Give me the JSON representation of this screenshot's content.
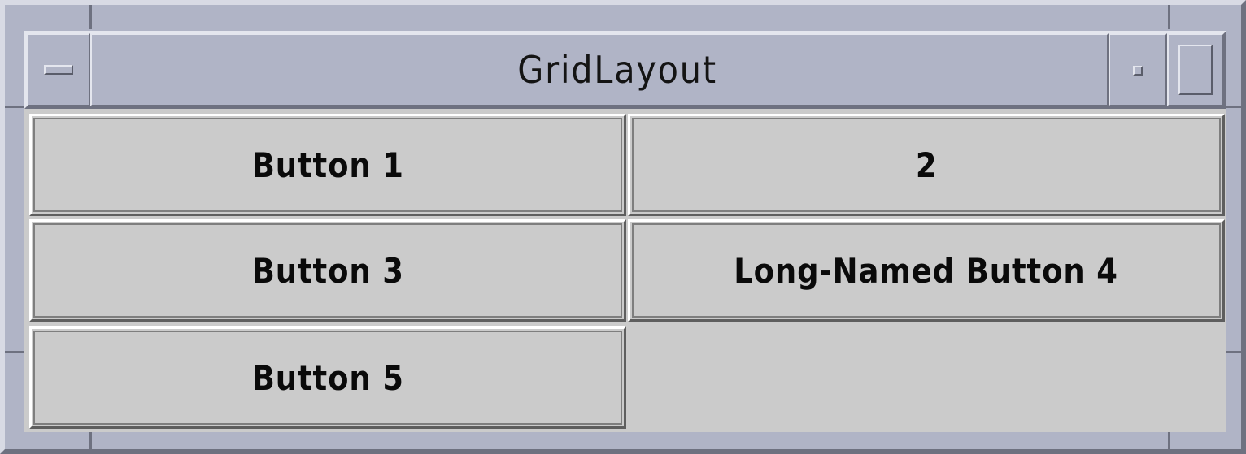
{
  "window": {
    "title": "GridLayout",
    "menu_icon": "window-menu-icon",
    "minimize_icon": "minimize-icon",
    "maximize_icon": "maximize-icon"
  },
  "buttons": [
    {
      "label": "Button 1"
    },
    {
      "label": "2"
    },
    {
      "label": "Button 3"
    },
    {
      "label": "Long-Named Button 4"
    },
    {
      "label": "Button 5"
    }
  ],
  "colors": {
    "frame": "#b0b4c6",
    "button_face": "#cbcbcb",
    "text": "#0a0a0a"
  }
}
